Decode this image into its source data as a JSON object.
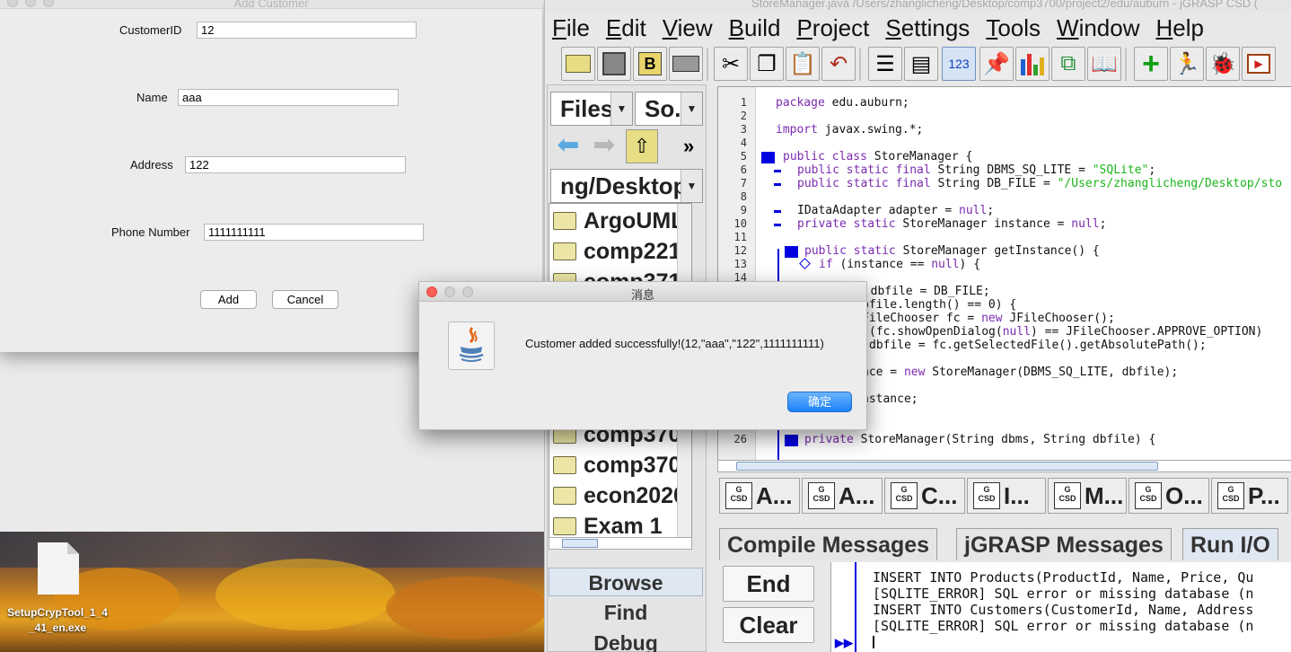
{
  "desktop": {
    "file_label_line1": "SetupCrypTool_1_4",
    "file_label_line2": "_41_en.exe"
  },
  "add_customer": {
    "window_title": "Add Customer",
    "fields": [
      {
        "label": "CustomerID",
        "value": "12"
      },
      {
        "label": "Name",
        "value": "aaa"
      },
      {
        "label": "Address",
        "value": "122"
      },
      {
        "label": "Phone Number",
        "value": "1111111111"
      }
    ],
    "add_label": "Add",
    "cancel_label": "Cancel"
  },
  "dialog": {
    "title": "消息",
    "message": "Customer added successfully!(12,\"aaa\",\"122\",1111111111)",
    "ok_label": "确定",
    "icon": "java-coffee-icon"
  },
  "jgrasp": {
    "window_title": "StoreManager.java  /Users/zhanglicheng/Desktop/comp3700/project2/edu/auburn - jGRASP CSD (",
    "menu": [
      "File",
      "Edit",
      "View",
      "Build",
      "Project",
      "Settings",
      "Tools",
      "Window",
      "Help"
    ],
    "toolbar_icons": [
      "open-folder-icon",
      "save-disk-icon",
      "bookmark-icon",
      "print-icon",
      "cut-icon",
      "copy-icon",
      "paste-icon",
      "undo-icon",
      "csd-icon",
      "remove-csd-icon",
      "line-numbers-icon",
      "pin-icon",
      "chart-icon",
      "tree-icon",
      "book-icon",
      "add-icon",
      "run-icon",
      "debug-bug-icon",
      "presentation-icon"
    ],
    "browse": {
      "files_combo": "Files",
      "sort_combo": "So...",
      "path_combo": "ng/Desktop",
      "more": "»",
      "folders": [
        "ArgoUML",
        "comp221",
        "comp371",
        "comp370",
        "comp370",
        "econ2020",
        "Exam 1"
      ],
      "tabs": [
        "Browse",
        "Find",
        "Debug"
      ]
    },
    "editor": {
      "lines": [
        {
          "n": "1",
          "text": "package edu.auburn;"
        },
        {
          "n": "2",
          "text": ""
        },
        {
          "n": "3",
          "text": "import javax.swing.*;"
        },
        {
          "n": "4",
          "text": ""
        },
        {
          "n": "5",
          "text": "public class StoreManager {"
        },
        {
          "n": "6",
          "text": "public static final String DBMS_SQ_LITE = \"SQLite\";"
        },
        {
          "n": "7",
          "text": "public static final String DB_FILE = \"/Users/zhanglicheng/Desktop/sto"
        },
        {
          "n": "8",
          "text": ""
        },
        {
          "n": "9",
          "text": "IDataAdapter adapter = null;"
        },
        {
          "n": "10",
          "text": "private static StoreManager instance = null;"
        },
        {
          "n": "11",
          "text": ""
        },
        {
          "n": "12",
          "text": "public static StoreManager getInstance() {"
        },
        {
          "n": "13",
          "text": "if (instance == null) {"
        },
        {
          "n": "14",
          "text": ""
        },
        {
          "n": "26",
          "text": "private StoreManager(String dbms, String dbfile) {"
        }
      ],
      "behind_dialog": [
        "g dbfile = DB_FILE;",
        "bfile.length() == 0) {",
        "FileChooser fc = new JFileChooser();",
        "(fc.showOpenDialog(null) == JFileChooser.APPROVE_OPTION)",
        "dbfile = fc.getSelectedFile().getAbsolutePath();",
        "nce = new StoreManager(DBMS_SQ_LITE, dbfile);",
        "nstance;"
      ]
    },
    "file_tabs": [
      "A...",
      "A...",
      "C...",
      "I...",
      "M...",
      "O...",
      "P..."
    ],
    "csd_label": "CSD",
    "message_tabs": [
      "Compile Messages",
      "jGRASP Messages",
      "Run I/O"
    ],
    "run_buttons": [
      "End",
      "Clear"
    ],
    "output": [
      "INSERT INTO Products(ProductId, Name, Price, Qu",
      "[SQLITE_ERROR] SQL error or missing database (n",
      "INSERT INTO Customers(CustomerId, Name, Address",
      "[SQLITE_ERROR] SQL error or missing database (n"
    ],
    "prompt": "▶▶"
  },
  "colors": {
    "keyword": "#7a2bb0",
    "string": "#1bb51b",
    "ok_button": "#1a82f7",
    "control_block": "#0000e0"
  }
}
